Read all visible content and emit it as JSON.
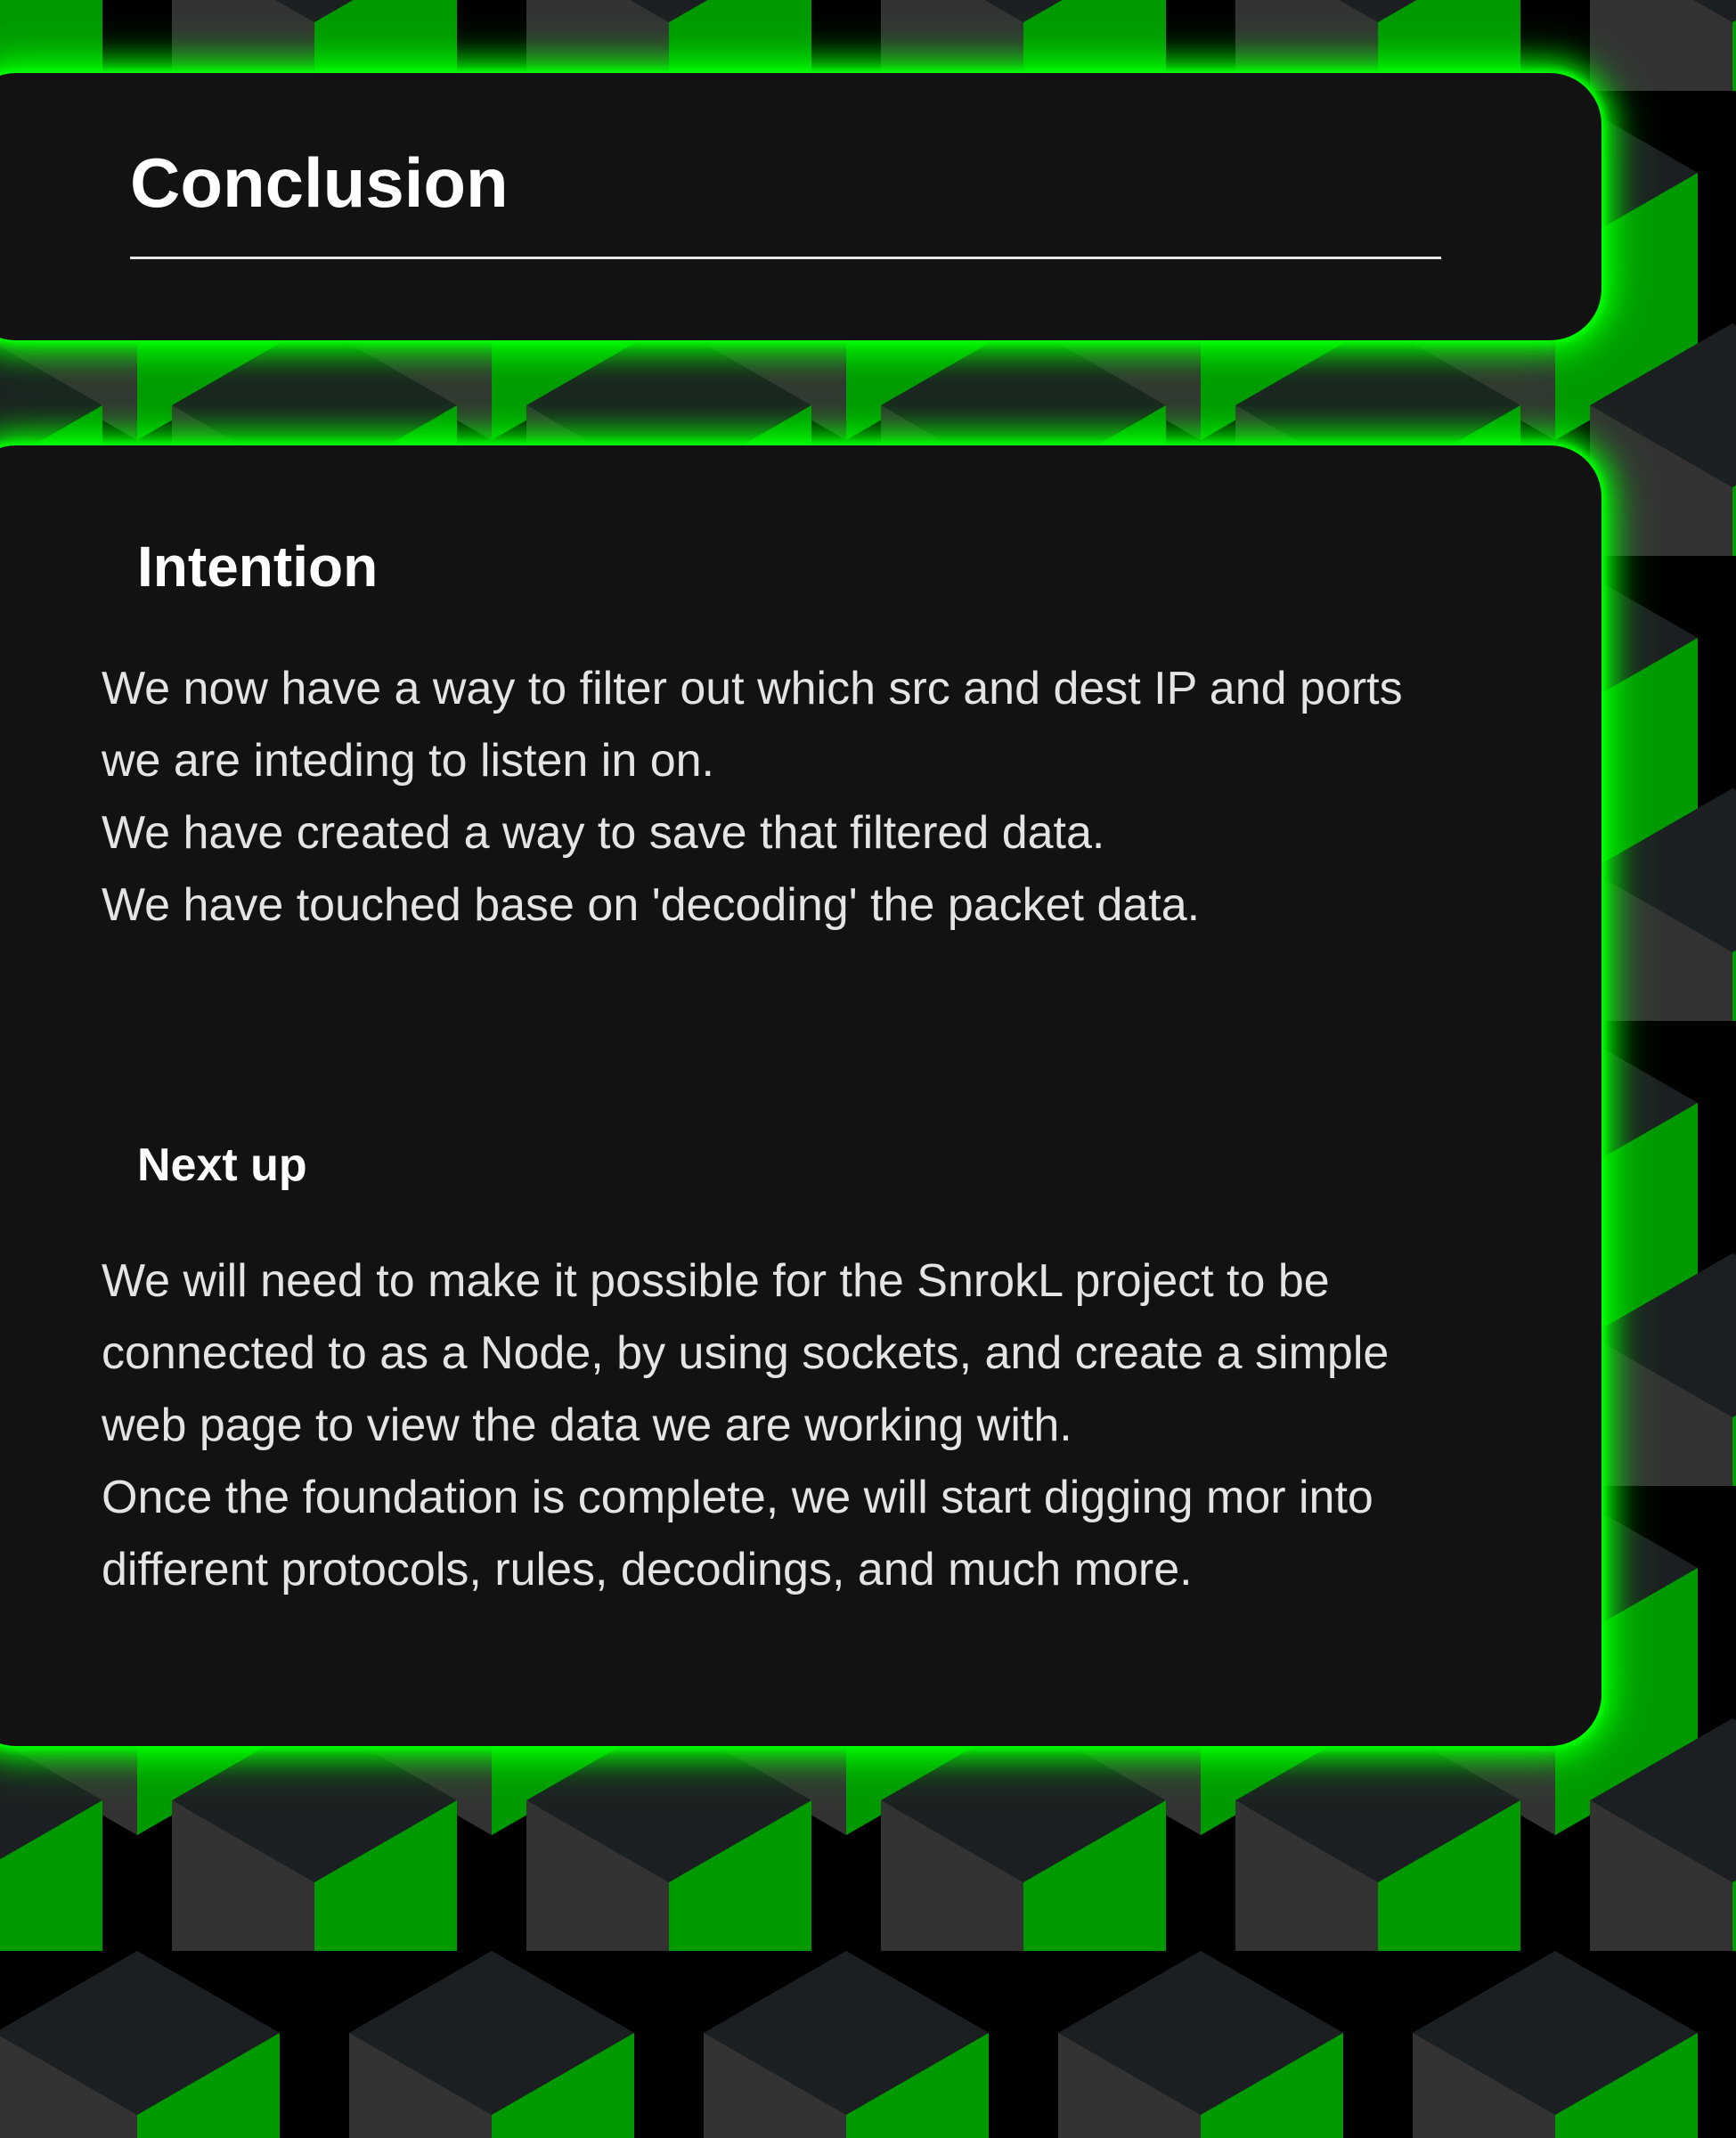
{
  "colors": {
    "accent_green": "#00ff00",
    "cube_green": "#009900",
    "cube_grey": "#333333",
    "cube_dark": "#1c1f22",
    "card_bg": "#121212",
    "heading_text": "#ffffff",
    "body_text": "#e4e4e4"
  },
  "header": {
    "title": "Conclusion"
  },
  "intention": {
    "heading": "Intention",
    "lines": [
      "We now have a way to filter out which src and dest IP and ports",
      "we are inteding to listen in on.",
      "We have created a way to save that filtered data.",
      "We have touched base on 'decoding' the packet data."
    ]
  },
  "next_up": {
    "heading": "Next up",
    "lines": [
      "We will need to make it possible for the SnrokL project to be",
      "connected to as a Node, by using sockets, and create a simple",
      "web page to view the data we are working with.",
      "Once the foundation is complete, we will start digging mor into",
      "different protocols, rules, decodings, and much more."
    ]
  }
}
